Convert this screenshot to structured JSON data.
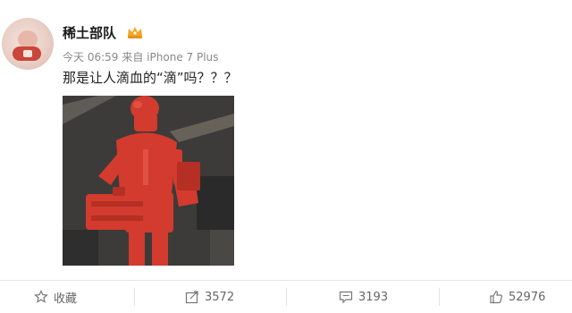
{
  "post": {
    "username": "稀土部队",
    "time": "今天 06:59",
    "source": "来自 iPhone 7 Plus",
    "text": "那是让人滴血的“滴”吗？？？"
  },
  "actions": {
    "favorite": "收藏",
    "repost": "3572",
    "comment": "3193",
    "like": "52976"
  },
  "icons": {
    "vip": "vip-crown-icon",
    "favorite": "star-icon",
    "repost": "share-icon",
    "comment": "comment-icon",
    "like": "thumbs-up-icon"
  },
  "colors": {
    "vip_badge": "#f5a623",
    "text_muted": "#888888",
    "figure_red": "#d23b2e"
  }
}
